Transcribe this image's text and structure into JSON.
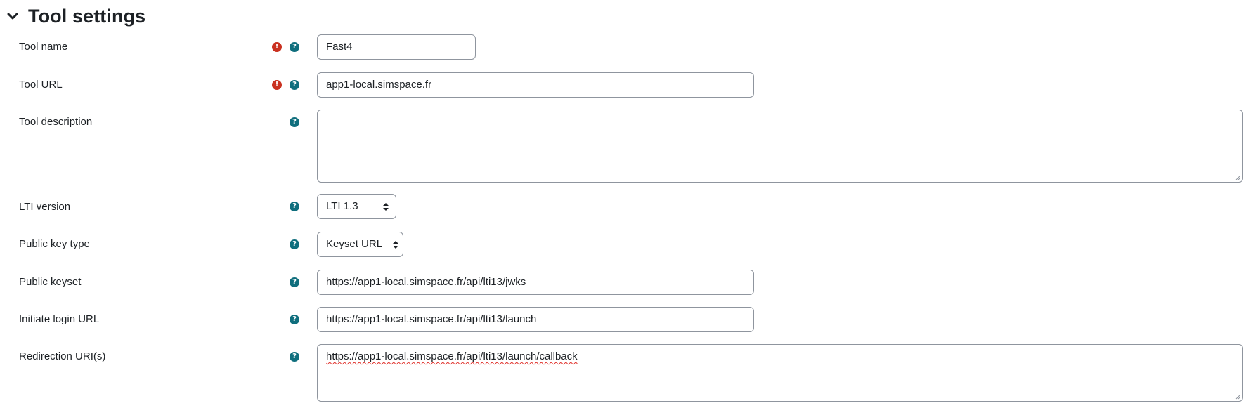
{
  "section": {
    "title": "Tool settings",
    "toggle_icon": "chevron-down-icon"
  },
  "fields": {
    "tool_name": {
      "label": "Tool name",
      "value": "Fast4",
      "required": true
    },
    "tool_url": {
      "label": "Tool URL",
      "value": "app1-local.simspace.fr",
      "required": true
    },
    "tool_description": {
      "label": "Tool description",
      "value": ""
    },
    "lti_version": {
      "label": "LTI version",
      "selected": "LTI 1.3"
    },
    "public_key_type": {
      "label": "Public key type",
      "selected": "Keyset URL"
    },
    "public_keyset": {
      "label": "Public keyset",
      "value": "https://app1-local.simspace.fr/api/lti13/jwks"
    },
    "initiate_login_url": {
      "label": "Initiate login URL",
      "value": "https://app1-local.simspace.fr/api/lti13/launch"
    },
    "redirection_uris": {
      "label": "Redirection URI(s)",
      "value": "https://app1-local.simspace.fr/api/lti13/launch/callback"
    }
  },
  "icons": {
    "required": "exclamation-icon",
    "help": "question-mark-icon",
    "required_glyph": "!",
    "help_glyph": "?"
  },
  "colors": {
    "required": "#ca3120",
    "help": "#0f6e7d",
    "border": "#8f959e",
    "text": "#1d2125"
  }
}
